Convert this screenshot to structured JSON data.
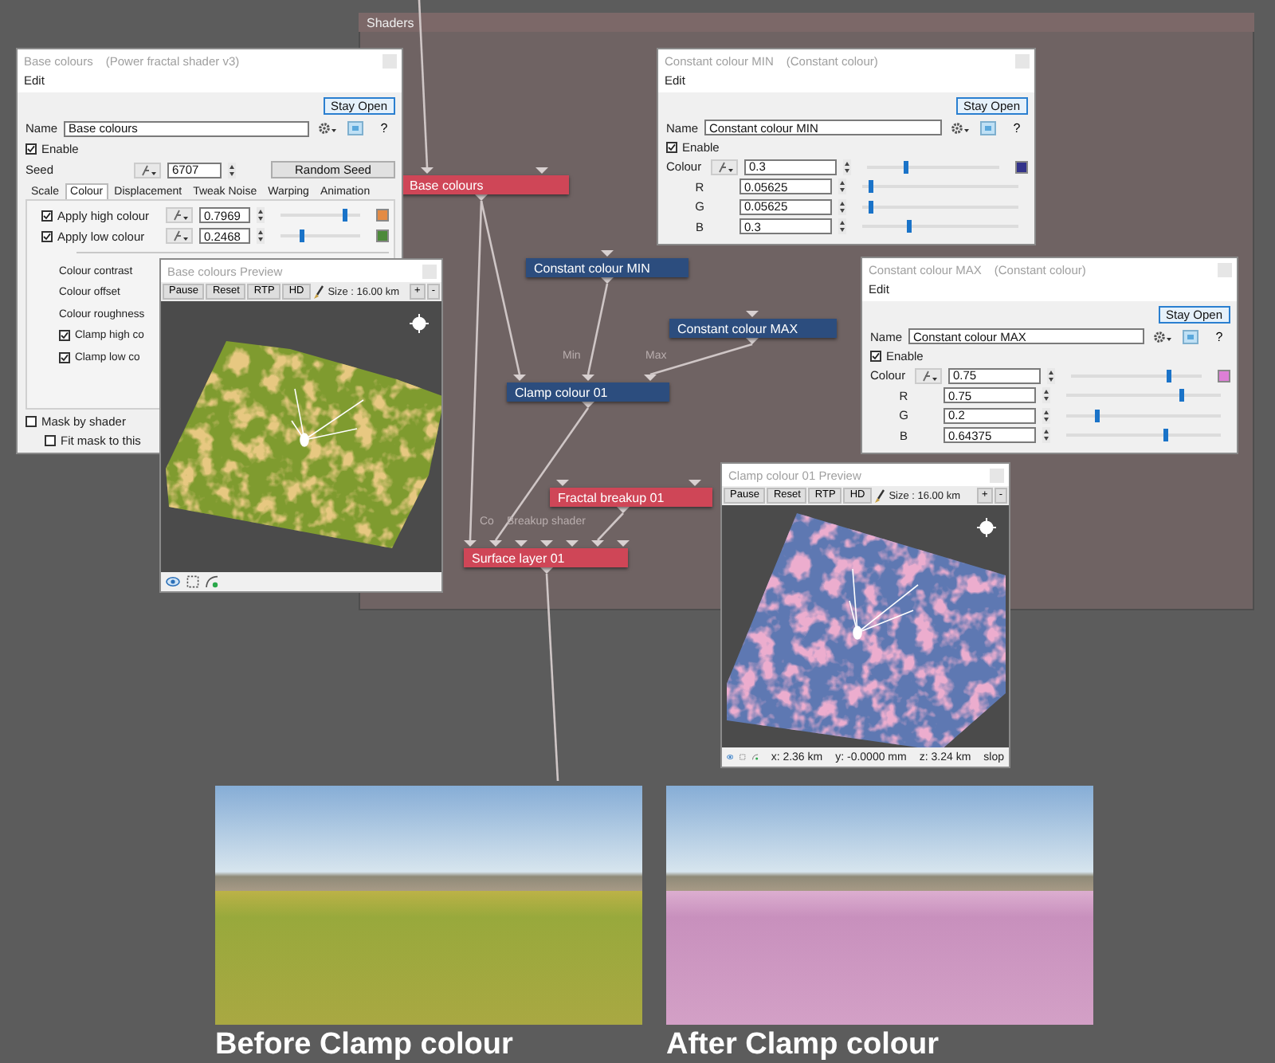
{
  "shaders_panel": {
    "title": "Shaders",
    "nodes": [
      {
        "label": "Base colours",
        "color": "#cf4657"
      },
      {
        "label": "Constant colour MIN",
        "color": "#2c4d7e"
      },
      {
        "label": "Constant colour MAX",
        "color": "#2c4d7e"
      },
      {
        "label": "Clamp colour 01",
        "color": "#2c4d7e"
      },
      {
        "label": "Fractal breakup 01",
        "color": "#cf4657"
      },
      {
        "label": "Surface layer 01",
        "color": "#cf4657"
      }
    ],
    "port_labels": [
      "Min",
      "Max",
      "Co",
      "Breakup shader"
    ]
  },
  "base_colours_window": {
    "title": "Base colours",
    "subtitle": "(Power fractal shader v3)",
    "menu": "Edit",
    "stay_open": "Stay Open",
    "name_label": "Name",
    "name_value": "Base colours",
    "help": "?",
    "enable": {
      "label": "Enable",
      "checked": true
    },
    "seed_label": "Seed",
    "seed_value": "6707",
    "random_seed": "Random Seed",
    "tabs": [
      {
        "label": "Scale",
        "selected": false
      },
      {
        "label": "Colour",
        "selected": true
      },
      {
        "label": "Displacement",
        "selected": false
      },
      {
        "label": "Tweak Noise",
        "selected": false
      },
      {
        "label": "Warping",
        "selected": false
      },
      {
        "label": "Animation",
        "selected": false
      }
    ],
    "colour_rows": [
      {
        "label": "Apply high colour",
        "checked": true,
        "value": "0.7969",
        "level": 0.8,
        "color": "#e38b45"
      },
      {
        "label": "Apply low colour",
        "checked": true,
        "value": "0.2468",
        "level": 0.26,
        "color": "#4d8a3a"
      }
    ],
    "options": [
      {
        "kind": "label",
        "label": "Colour contrast"
      },
      {
        "kind": "label",
        "label": "Colour offset"
      },
      {
        "kind": "label",
        "label": "Colour roughness"
      },
      {
        "kind": "checkbox",
        "label": "Clamp high co",
        "checked": true
      },
      {
        "kind": "checkbox",
        "label": "Clamp low co",
        "checked": true
      }
    ],
    "mask_options": [
      {
        "label": "Mask by shader",
        "checked": false,
        "children": [
          {
            "label": "Fit mask to this",
            "checked": false
          }
        ]
      }
    ]
  },
  "base_preview_window": {
    "title": "Base colours Preview",
    "buttons": [
      "Pause",
      "Reset",
      "RTP",
      "HD"
    ],
    "size": "Size : 16.00 km",
    "zoom_buttons": [
      "+",
      "-"
    ],
    "kind": "meadow"
  },
  "constant_min_window": {
    "title": "Constant colour MIN",
    "subtitle": "(Constant colour)",
    "menu": "Edit",
    "stay_open": "Stay Open",
    "name_label": "Name",
    "name_value": "Constant colour MIN",
    "help": "?",
    "enable": {
      "label": "Enable",
      "checked": true
    },
    "colour": {
      "label": "Colour",
      "value": "0.3",
      "level": 0.3,
      "color": "#33338a"
    },
    "channels": [
      {
        "label": "R",
        "value": "0.05625",
        "level": 0.06
      },
      {
        "label": "G",
        "value": "0.05625",
        "level": 0.06
      },
      {
        "label": "B",
        "value": "0.3",
        "level": 0.3
      }
    ]
  },
  "constant_max_window": {
    "title": "Constant colour MAX",
    "subtitle": "(Constant colour)",
    "menu": "Edit",
    "stay_open": "Stay Open",
    "name_label": "Name",
    "name_value": "Constant colour MAX",
    "help": "?",
    "enable": {
      "label": "Enable",
      "checked": true
    },
    "colour": {
      "label": "Colour",
      "value": "0.75",
      "level": 0.75,
      "color": "#dd7fd6"
    },
    "channels": [
      {
        "label": "R",
        "value": "0.75",
        "level": 0.75
      },
      {
        "label": "G",
        "value": "0.2",
        "level": 0.2
      },
      {
        "label": "B",
        "value": "0.64375",
        "level": 0.64
      }
    ]
  },
  "clamp_preview_window": {
    "title": "Clamp colour 01 Preview",
    "buttons": [
      "Pause",
      "Reset",
      "RTP",
      "HD"
    ],
    "size": "Size : 16.00 km",
    "zoom_buttons": [
      "+",
      "-"
    ],
    "kind": "clamped",
    "status": [
      "x: 2.36 km",
      "y: -0.0000 mm",
      "z: 3.24 km",
      "slop"
    ]
  },
  "comparison": [
    {
      "kind": "meadow",
      "caption": "Before Clamp colour"
    },
    {
      "kind": "clamped",
      "caption": "After Clamp colour"
    }
  ]
}
